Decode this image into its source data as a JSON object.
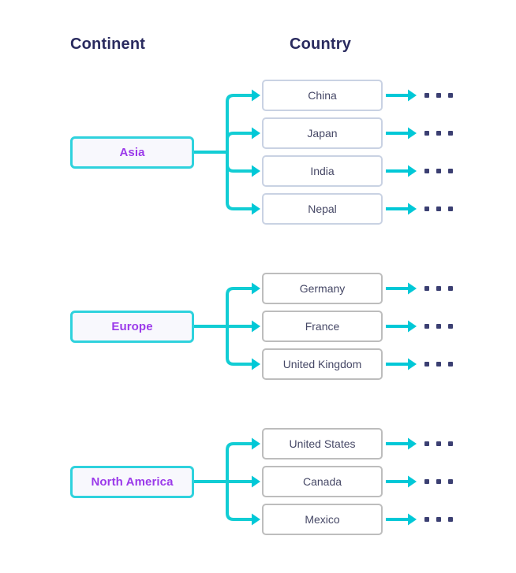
{
  "headers": {
    "continent": "Continent",
    "country": "Country"
  },
  "colors": {
    "background": "#ffffff",
    "header_text": "#2a2b5f",
    "continent_border": "#2fd2dd",
    "continent_fill": "#f8f8fd",
    "continent_text": "#9b3aea",
    "country_border_blue": "#c9d2e3",
    "country_border_gray": "#bdbdbd",
    "country_fill": "#ffffff",
    "country_text": "#464866",
    "connector": "#12cdd4",
    "arrow": "#00c8d7",
    "dot": "#3b3f72"
  },
  "groups": [
    {
      "continent": "Asia",
      "countries": [
        {
          "name": "China",
          "trailing": "..."
        },
        {
          "name": "Japan",
          "trailing": "..."
        },
        {
          "name": "India",
          "trailing": "..."
        },
        {
          "name": "Nepal",
          "trailing": "..."
        }
      ]
    },
    {
      "continent": "Europe",
      "countries": [
        {
          "name": "Germany",
          "trailing": "..."
        },
        {
          "name": "France",
          "trailing": "..."
        },
        {
          "name": "United Kingdom",
          "trailing": "..."
        }
      ]
    },
    {
      "continent": "North America",
      "countries": [
        {
          "name": "United States",
          "trailing": "..."
        },
        {
          "name": "Canada",
          "trailing": "..."
        },
        {
          "name": "Mexico",
          "trailing": "..."
        }
      ]
    }
  ]
}
